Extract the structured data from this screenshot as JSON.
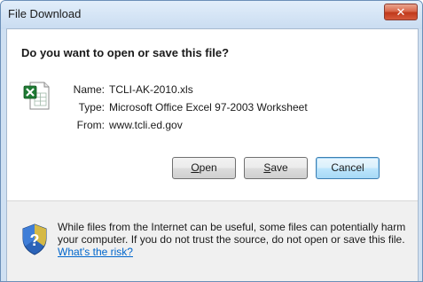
{
  "window": {
    "title": "File Download",
    "close_label": "✕"
  },
  "dialog": {
    "question": "Do you want to open or save this file?",
    "file_icon": "excel-file-icon",
    "fields": [
      {
        "label": "Name:",
        "value": "TCLI-AK-2010.xls"
      },
      {
        "label": "Type:",
        "value": "Microsoft Office Excel 97-2003 Worksheet"
      },
      {
        "label": "From:",
        "value": "www.tcli.ed.gov"
      }
    ],
    "buttons": {
      "open": {
        "label_mnemonic": "O",
        "label_rest": "pen"
      },
      "save": {
        "label_mnemonic": "S",
        "label_rest": "ave"
      },
      "cancel": {
        "label": "Cancel"
      }
    }
  },
  "footer": {
    "icon": "security-shield-icon",
    "warning_text": "While files from the Internet can be useful, some files can potentially harm your computer. If you do not trust the source, do not open or save this file.",
    "link_text": "What's the risk?"
  },
  "colors": {
    "frame": "#cfe0f2",
    "close_button": "#c0391b",
    "link": "#0066cc",
    "footer_bg": "#f0f0f0"
  }
}
